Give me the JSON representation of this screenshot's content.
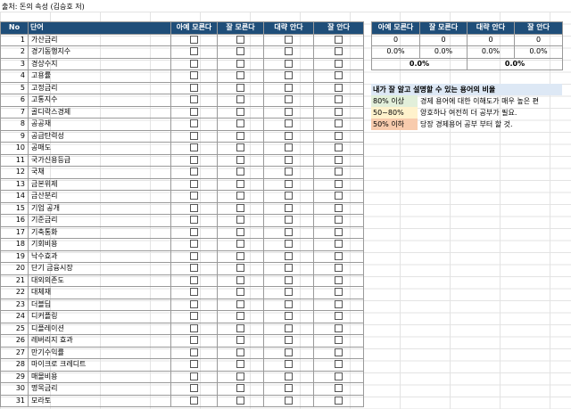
{
  "source": "출처: 돈의 속성 (김승호 저)",
  "table": {
    "headers": {
      "no": "No",
      "word": "단어",
      "c1": "아예 모른다",
      "c2": "잘 모른다",
      "c3": "대략 안다",
      "c4": "잘 안다"
    },
    "rows": [
      {
        "no": "1",
        "word": "가산금리"
      },
      {
        "no": "2",
        "word": "경기동행지수"
      },
      {
        "no": "3",
        "word": "경상수지"
      },
      {
        "no": "4",
        "word": "고용률"
      },
      {
        "no": "5",
        "word": "고정금리"
      },
      {
        "no": "6",
        "word": "고통지수"
      },
      {
        "no": "7",
        "word": "골디락스경제"
      },
      {
        "no": "8",
        "word": "공공재"
      },
      {
        "no": "9",
        "word": "공급탄력성"
      },
      {
        "no": "10",
        "word": "공매도"
      },
      {
        "no": "11",
        "word": "국가신용등급"
      },
      {
        "no": "12",
        "word": "국채"
      },
      {
        "no": "13",
        "word": "금본위제"
      },
      {
        "no": "14",
        "word": "금산분리"
      },
      {
        "no": "15",
        "word": "기업 공개"
      },
      {
        "no": "16",
        "word": "기준금리"
      },
      {
        "no": "17",
        "word": "기축통화"
      },
      {
        "no": "18",
        "word": "기회비용"
      },
      {
        "no": "19",
        "word": "낙수효과"
      },
      {
        "no": "20",
        "word": "단기 금융시장"
      },
      {
        "no": "21",
        "word": "대외의존도"
      },
      {
        "no": "22",
        "word": "대체재"
      },
      {
        "no": "23",
        "word": "더블딥"
      },
      {
        "no": "24",
        "word": "디커플링"
      },
      {
        "no": "25",
        "word": "디플레이션"
      },
      {
        "no": "26",
        "word": "레버리지 효과"
      },
      {
        "no": "27",
        "word": "만기수익률"
      },
      {
        "no": "28",
        "word": "마이크로 크레디트"
      },
      {
        "no": "29",
        "word": "매몰비용"
      },
      {
        "no": "30",
        "word": "명목금리"
      },
      {
        "no": "31",
        "word": "모라토"
      }
    ]
  },
  "stats": {
    "headers": [
      "아예 모른다",
      "잘 모른다",
      "대략 안다",
      "잘 안다"
    ],
    "counts": [
      "0",
      "0",
      "0",
      "0"
    ],
    "percents": [
      "0.0%",
      "0.0%",
      "0.0%",
      "0.0%"
    ],
    "merged": [
      "0.0%",
      "0.0%"
    ]
  },
  "legend": {
    "title": "내가 잘 알고 설명할 수 있는 용어의 비율",
    "rows": [
      {
        "range": "80% 이상",
        "desc": "경제 용어에 대한 이해도가 매우 높은 편",
        "color": "#e2efda"
      },
      {
        "range": "50~80%",
        "desc": "양호하나 여전히 더 공부가 필요.",
        "color": "#fff2cc"
      },
      {
        "range": "50% 이하",
        "desc": "당장 경제용어 공부 부터 할 것.",
        "color": "#f8cbad"
      }
    ]
  },
  "colors": {
    "header_bg": "#1f4e79",
    "legend_title_bg": "#dde8f5"
  }
}
